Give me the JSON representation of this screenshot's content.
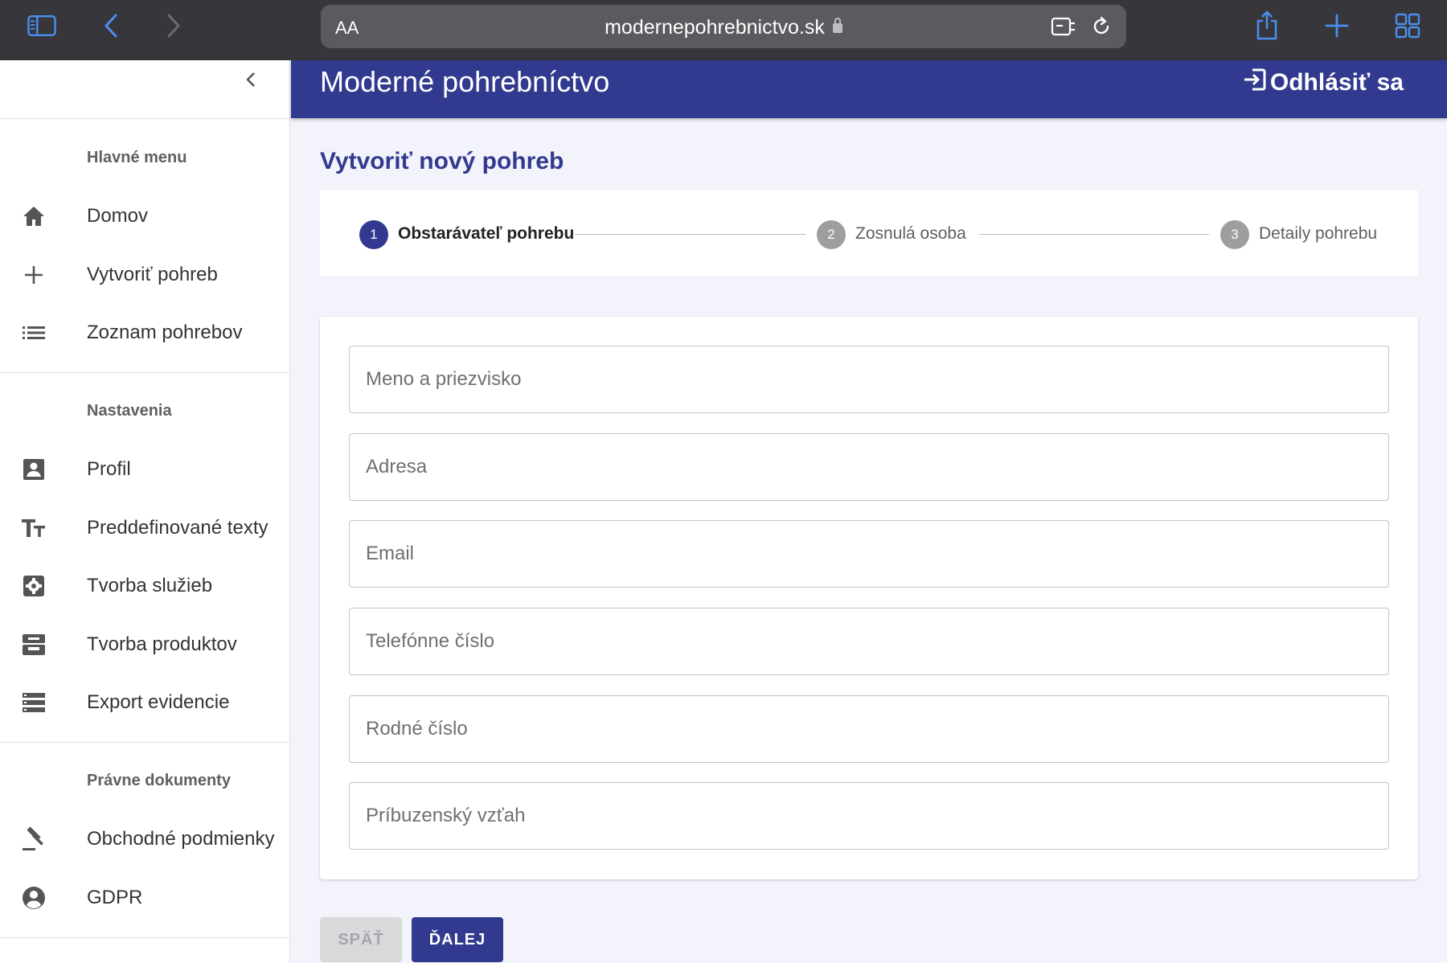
{
  "browser": {
    "text_size_label": "AA",
    "url": "modernepohrebnictvo.sk",
    "icons": [
      "sidebar-icon",
      "back-icon",
      "forward-icon",
      "reader-icon",
      "reload-icon",
      "share-icon",
      "new-tab-icon",
      "tabs-icon"
    ]
  },
  "app": {
    "title": "Moderné pohrebníctvo",
    "logout_label": "Odhlásiť sa",
    "accent_color": "#323a8f"
  },
  "sidebar": {
    "sections": [
      {
        "heading": "Hlavné menu",
        "items": [
          {
            "label": "Domov",
            "icon": "home-icon"
          },
          {
            "label": "Vytvoriť pohreb",
            "icon": "plus-icon"
          },
          {
            "label": "Zoznam pohrebov",
            "icon": "list-icon"
          }
        ]
      },
      {
        "heading": "Nastavenia",
        "items": [
          {
            "label": "Profil",
            "icon": "profile-icon"
          },
          {
            "label": "Preddefinované texty",
            "icon": "text-fields-icon"
          },
          {
            "label": "Tvorba služieb",
            "icon": "settings-box-icon"
          },
          {
            "label": "Tvorba produktov",
            "icon": "inbox-icon"
          },
          {
            "label": "Export evidencie",
            "icon": "storage-icon"
          }
        ]
      },
      {
        "heading": "Právne dokumenty",
        "items": [
          {
            "label": "Obchodné podmienky",
            "icon": "gavel-icon"
          },
          {
            "label": "GDPR",
            "icon": "account-circle-icon"
          }
        ]
      }
    ]
  },
  "main": {
    "page_title": "Vytvoriť nový pohreb",
    "steps": [
      {
        "number": "1",
        "label": "Obstarávateľ pohrebu",
        "active": true
      },
      {
        "number": "2",
        "label": "Zosnulá osoba",
        "active": false
      },
      {
        "number": "3",
        "label": "Detaily pohrebu",
        "active": false
      }
    ],
    "form": {
      "fields": [
        {
          "placeholder": "Meno a priezvisko",
          "value": ""
        },
        {
          "placeholder": "Adresa",
          "value": ""
        },
        {
          "placeholder": "Email",
          "value": ""
        },
        {
          "placeholder": "Telefónne číslo",
          "value": ""
        },
        {
          "placeholder": "Rodné číslo",
          "value": ""
        },
        {
          "placeholder": "Príbuzenský vzťah",
          "value": ""
        }
      ]
    },
    "buttons": {
      "back_label": "SPÄŤ",
      "next_label": "ĎALEJ"
    }
  }
}
